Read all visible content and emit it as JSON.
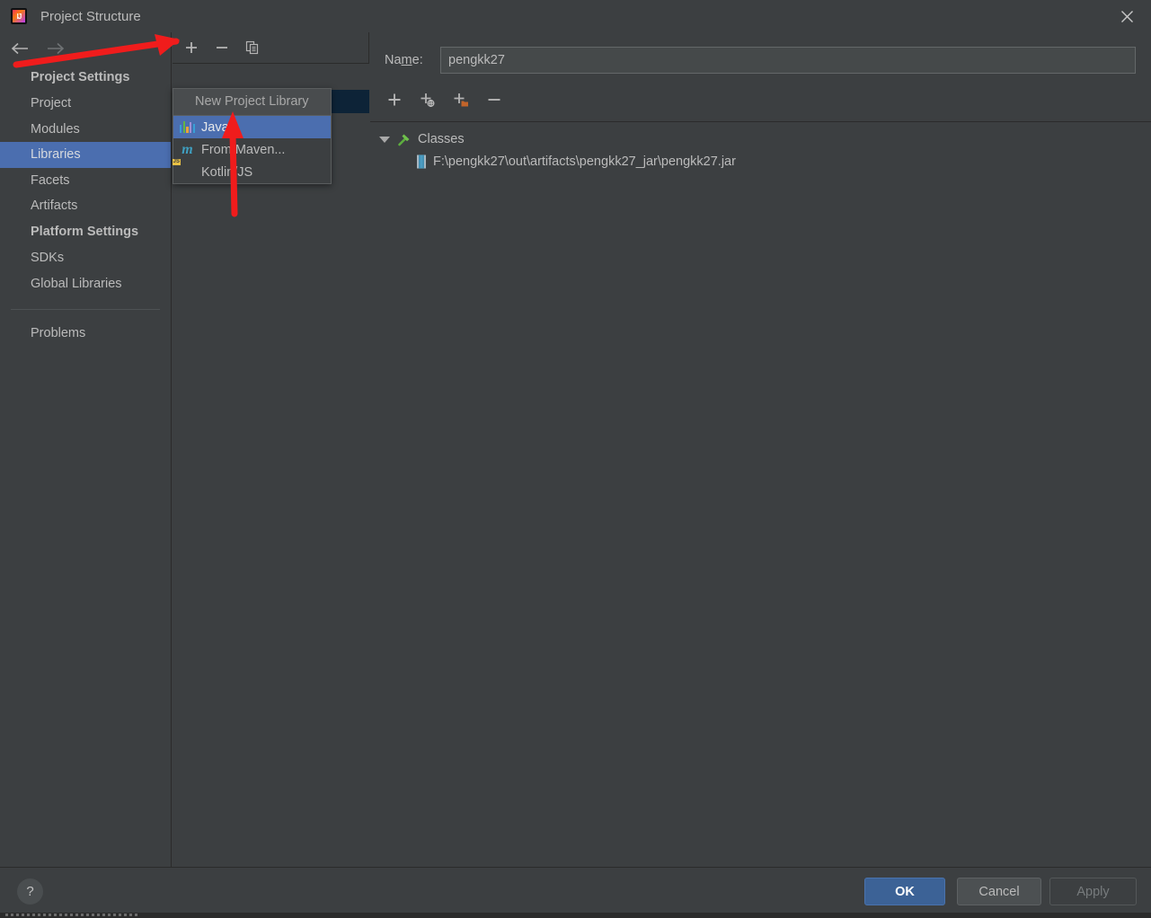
{
  "window": {
    "title": "Project Structure",
    "app_icon": "intellij-idea-icon",
    "close_icon": "close-icon"
  },
  "sidebar": {
    "back_icon": "arrow-left-icon",
    "forward_icon": "arrow-right-icon",
    "groups": [
      {
        "header": "Project Settings",
        "items": [
          {
            "label": "Project",
            "selected": false
          },
          {
            "label": "Modules",
            "selected": false
          },
          {
            "label": "Libraries",
            "selected": true
          },
          {
            "label": "Facets",
            "selected": false
          },
          {
            "label": "Artifacts",
            "selected": false
          }
        ]
      },
      {
        "header": "Platform Settings",
        "items": [
          {
            "label": "SDKs",
            "selected": false
          },
          {
            "label": "Global Libraries",
            "selected": false
          }
        ]
      }
    ],
    "extra_items": [
      {
        "label": "Problems",
        "selected": false
      }
    ]
  },
  "libraries_panel": {
    "toolbar": [
      {
        "name": "add-library-button",
        "icon": "plus-icon",
        "label": "+"
      },
      {
        "name": "remove-library-button",
        "icon": "minus-icon",
        "label": "−"
      },
      {
        "name": "copy-library-button",
        "icon": "copy-icon",
        "label": "Copy"
      }
    ],
    "popup": {
      "title": "New Project Library",
      "items": [
        {
          "label": "Java",
          "icon": "java-icon",
          "selected": true
        },
        {
          "label": "From Maven...",
          "icon": "maven-icon",
          "selected": false
        },
        {
          "label": "Kotlin/JS",
          "icon": "kotlin-js-icon",
          "selected": false
        }
      ]
    }
  },
  "detail": {
    "name_label_before": "Na",
    "name_label_mnemonic": "m",
    "name_label_after": "e:",
    "name_value": "pengkk27",
    "toolbar": [
      {
        "name": "add-button",
        "icon": "plus-icon"
      },
      {
        "name": "add-from-repo-button",
        "icon": "plus-globe-icon"
      },
      {
        "name": "add-directory-button",
        "icon": "plus-folder-icon"
      },
      {
        "name": "remove-entry-button",
        "icon": "minus-icon"
      }
    ],
    "tree": {
      "root": {
        "label": "Classes",
        "icon": "hammer-icon",
        "expanded": true
      },
      "children": [
        {
          "label": "F:\\pengkk27\\out\\artifacts\\pengkk27_jar\\pengkk27.jar",
          "icon": "jar-file-icon"
        }
      ]
    }
  },
  "footer": {
    "help_label": "?",
    "ok_label": "OK",
    "cancel_label": "Cancel",
    "apply_label": "Apply"
  },
  "colors": {
    "background": "#3c3f41",
    "selection_blue": "#4b6eaf",
    "row_selected_navy": "#0d2337",
    "ok_button": "#3c6296",
    "annotation_red": "#f01c1c",
    "text": "#bbbbbb"
  },
  "annotations": [
    {
      "name": "arrow-to-add-button",
      "type": "arrow",
      "color": "#f01c1c"
    },
    {
      "name": "arrow-to-java-item",
      "type": "arrow",
      "color": "#f01c1c"
    }
  ]
}
